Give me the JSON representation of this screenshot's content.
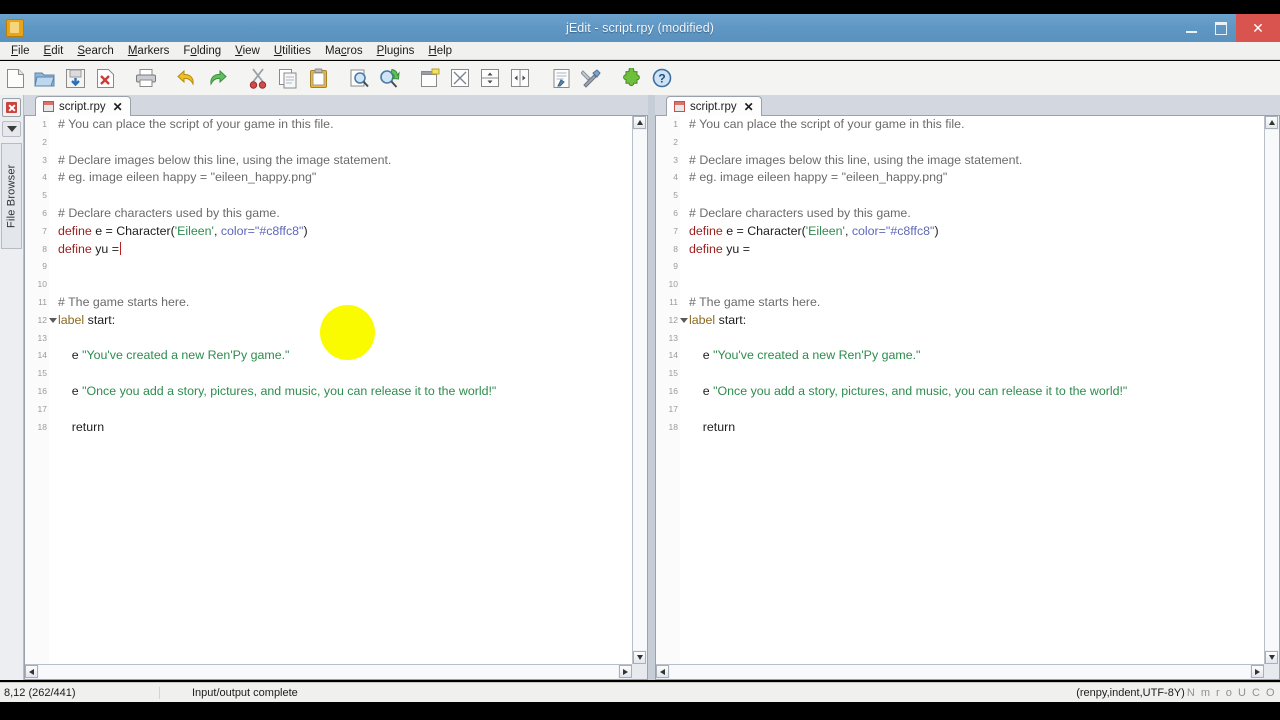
{
  "window": {
    "title": "jEdit - script.rpy (modified)",
    "app_icon": "jedit-icon",
    "minimize_label": "—",
    "maximize_label": "❐",
    "close_label": "✕",
    "accent_titlebar": "#5e96c4",
    "accent_close": "#d9534f"
  },
  "menubar": {
    "items": [
      {
        "label": "File",
        "mnemonic": "F"
      },
      {
        "label": "Edit",
        "mnemonic": "E"
      },
      {
        "label": "Search",
        "mnemonic": "S"
      },
      {
        "label": "Markers",
        "mnemonic": "M"
      },
      {
        "label": "Folding",
        "mnemonic": "o"
      },
      {
        "label": "View",
        "mnemonic": "V"
      },
      {
        "label": "Utilities",
        "mnemonic": "U"
      },
      {
        "label": "Macros",
        "mnemonic": "c"
      },
      {
        "label": "Plugins",
        "mnemonic": "P"
      },
      {
        "label": "Help",
        "mnemonic": "H"
      }
    ]
  },
  "toolbar": {
    "buttons": [
      {
        "name": "new-file-icon",
        "title": "New File"
      },
      {
        "name": "open-file-icon",
        "title": "Open File"
      },
      {
        "name": "save-icon",
        "title": "Save"
      },
      {
        "name": "close-file-icon",
        "title": "Close File"
      },
      {
        "name": "print-icon",
        "title": "Print"
      },
      {
        "name": "undo-icon",
        "title": "Undo"
      },
      {
        "name": "redo-icon",
        "title": "Redo"
      },
      {
        "name": "cut-icon",
        "title": "Cut"
      },
      {
        "name": "copy-icon",
        "title": "Copy"
      },
      {
        "name": "paste-icon",
        "title": "Paste"
      },
      {
        "name": "find-icon",
        "title": "Find"
      },
      {
        "name": "find-next-icon",
        "title": "Find Next"
      },
      {
        "name": "new-view-icon",
        "title": "New View"
      },
      {
        "name": "unsplit-icon",
        "title": "Unsplit"
      },
      {
        "name": "split-horizontal-icon",
        "title": "Split Horizontally"
      },
      {
        "name": "split-vertical-icon",
        "title": "Split Vertically"
      },
      {
        "name": "buffer-options-icon",
        "title": "Buffer Options"
      },
      {
        "name": "global-options-icon",
        "title": "Global Options"
      },
      {
        "name": "plugin-manager-icon",
        "title": "Plugin Manager"
      },
      {
        "name": "help-icon",
        "title": "Help"
      }
    ]
  },
  "dockbar": {
    "close_label": "",
    "dropdown_label": "",
    "file_browser_label": "File Browser"
  },
  "panes": [
    {
      "id": "left",
      "tab": {
        "label": "script.rpy",
        "close_label": "✕"
      },
      "has_caret": true
    },
    {
      "id": "right",
      "tab": {
        "label": "script.rpy",
        "close_label": "✕"
      },
      "has_caret": false
    }
  ],
  "code": {
    "lines": [
      {
        "n": 1,
        "fold": false,
        "tokens": [
          {
            "t": "# You can place the script of your game in this file.",
            "c": "c-comment"
          }
        ]
      },
      {
        "n": 2,
        "fold": false,
        "tokens": []
      },
      {
        "n": 3,
        "fold": false,
        "tokens": [
          {
            "t": "# Declare images below this line, using the image statement.",
            "c": "c-comment"
          }
        ]
      },
      {
        "n": 4,
        "fold": false,
        "tokens": [
          {
            "t": "# eg. image eileen happy = \"eileen_happy.png\"",
            "c": "c-comment"
          }
        ]
      },
      {
        "n": 5,
        "fold": false,
        "tokens": []
      },
      {
        "n": 6,
        "fold": false,
        "tokens": [
          {
            "t": "# Declare characters used by this game.",
            "c": "c-comment"
          }
        ]
      },
      {
        "n": 7,
        "fold": false,
        "tokens": [
          {
            "t": "define",
            "c": "c-kw"
          },
          {
            "t": " e = Character(",
            "c": "c-plain"
          },
          {
            "t": "'Eileen'",
            "c": "c-str"
          },
          {
            "t": ", ",
            "c": "c-plain"
          },
          {
            "t": "color=\"#c8ffc8\"",
            "c": "c-attr"
          },
          {
            "t": ")",
            "c": "c-plain"
          }
        ]
      },
      {
        "n": 8,
        "fold": false,
        "caret": true,
        "tokens": [
          {
            "t": "define",
            "c": "c-kw"
          },
          {
            "t": " yu =",
            "c": "c-plain"
          }
        ]
      },
      {
        "n": 9,
        "fold": false,
        "tokens": []
      },
      {
        "n": 10,
        "fold": false,
        "tokens": []
      },
      {
        "n": 11,
        "fold": false,
        "tokens": [
          {
            "t": "# The game starts here.",
            "c": "c-comment"
          }
        ]
      },
      {
        "n": 12,
        "fold": true,
        "tokens": [
          {
            "t": "label",
            "c": "c-label"
          },
          {
            "t": " start:",
            "c": "c-plain"
          }
        ]
      },
      {
        "n": 13,
        "fold": false,
        "tokens": []
      },
      {
        "n": 14,
        "fold": false,
        "tokens": [
          {
            "t": "    e ",
            "c": "c-plain"
          },
          {
            "t": "\"You've created a new Ren'Py game.\"",
            "c": "c-str"
          }
        ]
      },
      {
        "n": 15,
        "fold": false,
        "tokens": []
      },
      {
        "n": 16,
        "fold": false,
        "tokens": [
          {
            "t": "    e ",
            "c": "c-plain"
          },
          {
            "t": "\"Once you add a story, pictures, and music, you can release it to the world!\"",
            "c": "c-str"
          }
        ]
      },
      {
        "n": 17,
        "fold": false,
        "tokens": []
      },
      {
        "n": 18,
        "fold": false,
        "tokens": [
          {
            "t": "    return",
            "c": "c-plain"
          }
        ]
      }
    ]
  },
  "statusbar": {
    "caret_position": "8,12 (262/441)",
    "message": "Input/output complete",
    "mode_info": "(renpy,indent,UTF-8Y)",
    "flags": "N m r o U C O"
  },
  "overlay": {
    "click_indicator_color": "#fbfb00"
  }
}
